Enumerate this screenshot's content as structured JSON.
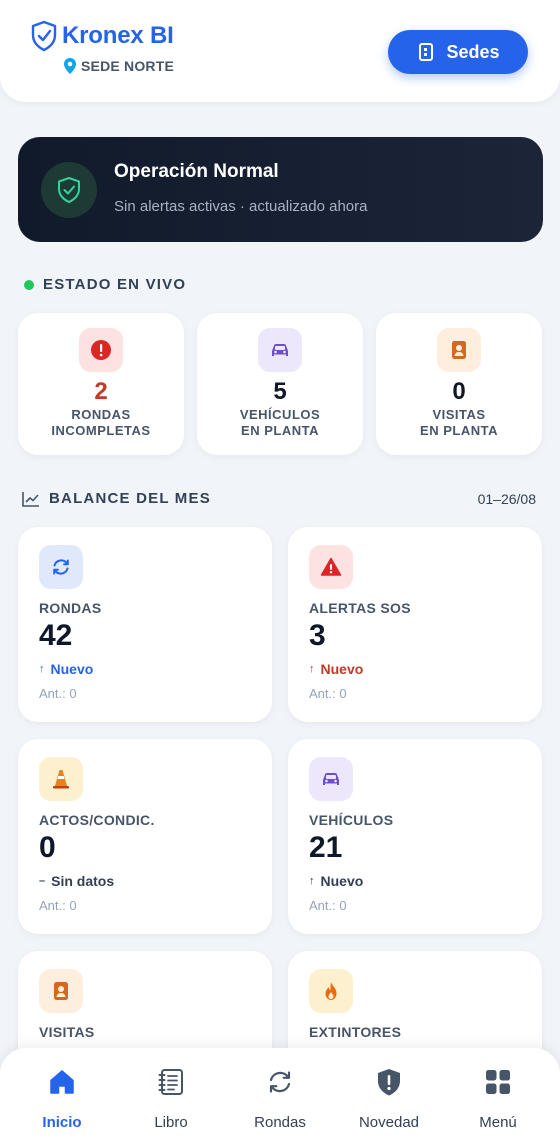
{
  "header": {
    "brand": "Kronex BI",
    "site": "SEDE NORTE",
    "sedes_button": "Sedes"
  },
  "status": {
    "title": "Operación Normal",
    "subtitle": "Sin alertas activas · actualizado ahora"
  },
  "live": {
    "title": "ESTADO EN VIVO",
    "cards": [
      {
        "value": "2",
        "label_line1": "RONDAS",
        "label_line2": "INCOMPLETAS",
        "icon": "alert-circle-icon",
        "value_color": "#c0392b",
        "icon_bg": "#fde2e2"
      },
      {
        "value": "5",
        "label_line1": "VEHÍCULOS",
        "label_line2": "EN PLANTA",
        "icon": "car-icon",
        "value_color": "#0f172a",
        "icon_bg": "#ede7fb"
      },
      {
        "value": "0",
        "label_line1": "VISITAS",
        "label_line2": "EN PLANTA",
        "icon": "badge-icon",
        "value_color": "#0f172a",
        "icon_bg": "#fdeede"
      }
    ]
  },
  "balance": {
    "title": "BALANCE DEL MES",
    "date_range": "01–26/08",
    "cards": [
      {
        "label": "RONDAS",
        "value": "42",
        "trend_arrow": "↑",
        "trend": "Nuevo",
        "trend_color": "#2563eb",
        "prev": "Ant.: 0",
        "icon": "refresh-icon",
        "icon_bg": "#dfe9fb"
      },
      {
        "label": "ALERTAS SOS",
        "value": "3",
        "trend_arrow": "↑",
        "trend": "Nuevo",
        "trend_color": "#c0392b",
        "prev": "Ant.: 0",
        "icon": "warning-triangle-icon",
        "icon_bg": "#fde2e2"
      },
      {
        "label": "ACTOS/CONDIC.",
        "value": "0",
        "trend_arrow": "–",
        "trend": "Sin datos",
        "trend_color": "#334155",
        "prev": "Ant.: 0",
        "icon": "traffic-cone-icon",
        "icon_bg": "#fdf0cf"
      },
      {
        "label": "VEHÍCULOS",
        "value": "21",
        "trend_arrow": "↑",
        "trend": "Nuevo",
        "trend_color": "#334155",
        "prev": "Ant.: 0",
        "icon": "car-icon",
        "icon_bg": "#ede7fb"
      },
      {
        "label": "VISITAS",
        "value": "",
        "icon": "badge-icon",
        "icon_bg": "#fdeede"
      },
      {
        "label": "EXTINTORES",
        "value": "",
        "icon": "fire-icon",
        "icon_bg": "#fdf0cf"
      }
    ]
  },
  "nav": {
    "items": [
      {
        "label": "Inicio",
        "icon": "home-icon",
        "active": true
      },
      {
        "label": "Libro",
        "icon": "logbook-icon",
        "active": false
      },
      {
        "label": "Rondas",
        "icon": "refresh-icon",
        "active": false
      },
      {
        "label": "Novedad",
        "icon": "shield-alert-icon",
        "active": false
      },
      {
        "label": "Menú",
        "icon": "grid-icon",
        "active": false
      }
    ]
  },
  "colors": {
    "accent": "#2563eb",
    "background": "#f1f4f9",
    "banner": "#151e30",
    "live_dot": "#22c55e"
  }
}
